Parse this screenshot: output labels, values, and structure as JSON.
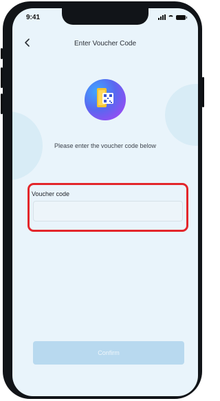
{
  "status_bar": {
    "time": "9:41"
  },
  "header": {
    "title": "Enter Voucher Code"
  },
  "main": {
    "prompt": "Please enter the voucher code below",
    "voucher_field": {
      "label": "Voucher code",
      "value": "",
      "placeholder": ""
    },
    "confirm_label": "Confirm"
  },
  "colors": {
    "screen_bg": "#e9f4fb",
    "highlight": "#e3262b",
    "button_disabled": "#b8d9ef"
  }
}
